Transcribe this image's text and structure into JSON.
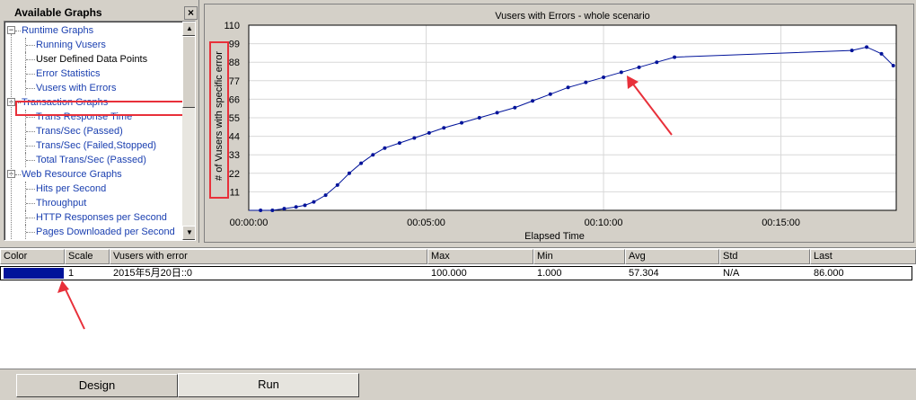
{
  "panel": {
    "title": "Available Graphs",
    "close_label": "×"
  },
  "tree": [
    {
      "label": "Runtime Graphs",
      "level": 0,
      "toggle": "−",
      "name": "tree-node-runtime-graphs"
    },
    {
      "label": "Running Vusers",
      "level": 1,
      "name": "tree-item-running-vusers"
    },
    {
      "label": "User Defined Data Points",
      "level": 1,
      "dark": true,
      "name": "tree-item-user-defined-data-points"
    },
    {
      "label": "Error Statistics",
      "level": 1,
      "name": "tree-item-error-statistics"
    },
    {
      "label": "Vusers with Errors",
      "level": 1,
      "name": "tree-item-vusers-with-errors"
    },
    {
      "label": "Transaction Graphs",
      "level": 0,
      "toggle": "−",
      "name": "tree-node-transaction-graphs"
    },
    {
      "label": "Trans Response Time",
      "level": 1,
      "name": "tree-item-trans-response-time"
    },
    {
      "label": "Trans/Sec (Passed)",
      "level": 1,
      "name": "tree-item-trans-sec-passed"
    },
    {
      "label": "Trans/Sec (Failed,Stopped)",
      "level": 1,
      "name": "tree-item-trans-sec-failed"
    },
    {
      "label": "Total Trans/Sec (Passed)",
      "level": 1,
      "name": "tree-item-total-trans-sec"
    },
    {
      "label": "Web Resource Graphs",
      "level": 0,
      "toggle": "−",
      "name": "tree-node-web-resource-graphs"
    },
    {
      "label": "Hits per Second",
      "level": 1,
      "name": "tree-item-hits-per-second"
    },
    {
      "label": "Throughput",
      "level": 1,
      "name": "tree-item-throughput"
    },
    {
      "label": "HTTP Responses per Second",
      "level": 1,
      "name": "tree-item-http-responses"
    },
    {
      "label": "Pages Downloaded per Second",
      "level": 1,
      "name": "tree-item-pages-downloaded"
    }
  ],
  "chart_data": {
    "type": "line",
    "title": "Vusers with Errors - whole scenario",
    "xlabel": "Elapsed Time",
    "ylabel": "# of Vusers with specific error",
    "x_ticks": [
      "00:00:00",
      "00:05:00",
      "00:10:00",
      "00:15:00"
    ],
    "x_tick_seconds": [
      0,
      300,
      600,
      900
    ],
    "y_ticks": [
      11,
      22,
      33,
      44,
      55,
      66,
      77,
      88,
      99,
      110
    ],
    "ylim": [
      0,
      110
    ],
    "xlim_seconds": [
      0,
      1095
    ],
    "grid": true,
    "series": [
      {
        "name": "Vusers with error",
        "color": "#00139a",
        "x_seconds": [
          0,
          20,
          40,
          60,
          80,
          95,
          110,
          130,
          150,
          170,
          190,
          210,
          230,
          255,
          280,
          305,
          330,
          360,
          390,
          420,
          450,
          480,
          510,
          540,
          570,
          600,
          630,
          660,
          690,
          720,
          1020,
          1045,
          1070,
          1090
        ],
        "y": [
          0,
          0,
          0,
          1,
          2,
          3,
          5,
          9,
          15,
          22,
          28,
          33,
          37,
          40,
          43,
          46,
          49,
          52,
          55,
          58,
          61,
          65,
          69,
          73,
          76,
          79,
          82,
          85,
          88,
          91,
          95,
          97,
          93,
          86
        ]
      }
    ]
  },
  "legend": {
    "headers": {
      "color": "Color",
      "scale": "Scale",
      "measurement": "Vusers with error",
      "max": "Max",
      "min": "Min",
      "avg": "Avg",
      "std": "Std",
      "last": "Last"
    },
    "row": {
      "swatch_color": "#00139a",
      "scale": "1",
      "measurement": "2015年5月20日::0",
      "max": "100.000",
      "min": "1.000",
      "avg": "57.304",
      "std": "N/A",
      "last": "86.000"
    }
  },
  "tabs": [
    {
      "label": "Design",
      "active": false
    },
    {
      "label": "Run",
      "active": true
    }
  ],
  "annotations": {
    "highlight_color": "#e8303a"
  }
}
